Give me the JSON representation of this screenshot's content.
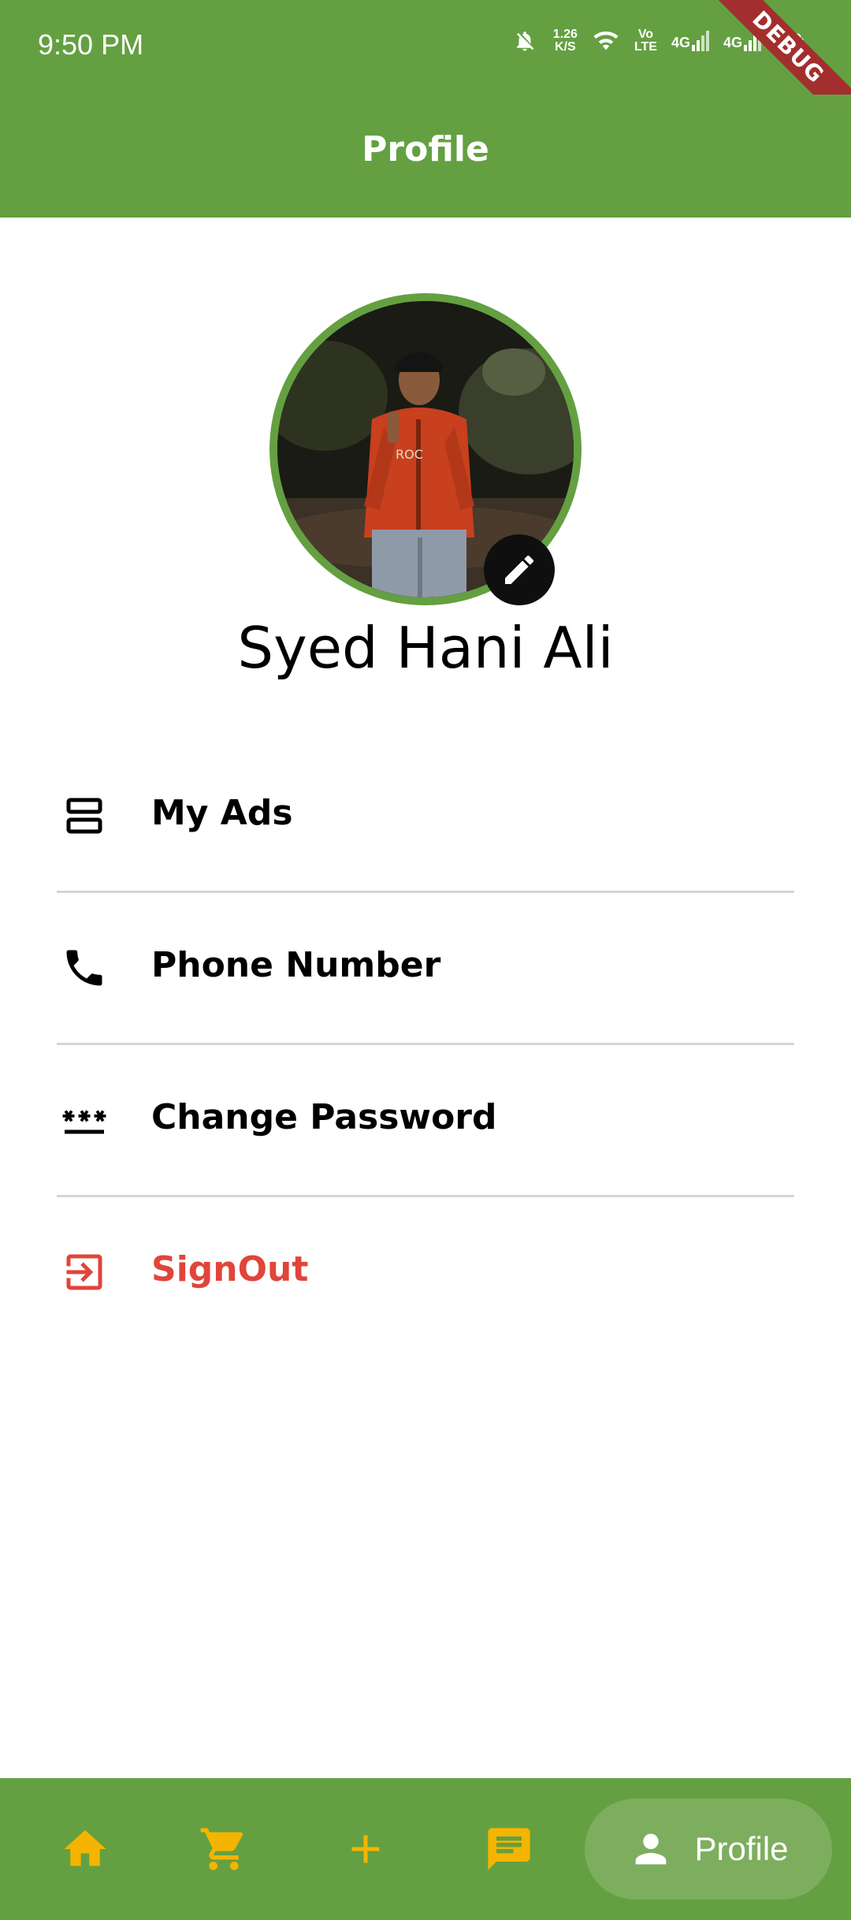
{
  "status_bar": {
    "time": "9:50 PM",
    "net_speed_value": "1.26",
    "net_speed_unit": "K/S",
    "volte_top": "Vo",
    "volte_bottom": "LTE",
    "network_1": "4G",
    "network_2": "4G",
    "debug_banner": "DEBUG"
  },
  "app_bar": {
    "title": "Profile"
  },
  "profile": {
    "name": "Syed Hani Ali"
  },
  "menu": {
    "items": [
      {
        "label": "My Ads",
        "icon": "ads-list-icon"
      },
      {
        "label": "Phone Number",
        "icon": "phone-icon"
      },
      {
        "label": "Change Password",
        "icon": "password-icon"
      },
      {
        "label": "SignOut",
        "icon": "signout-icon",
        "color": "#e0453a"
      }
    ]
  },
  "bottom_nav": {
    "items": [
      {
        "icon": "home-icon"
      },
      {
        "icon": "cart-icon"
      },
      {
        "icon": "add-icon"
      },
      {
        "icon": "chat-icon"
      },
      {
        "icon": "person-icon",
        "label": "Profile",
        "active": true
      }
    ]
  },
  "colors": {
    "primary_green": "#64a041",
    "nav_icon": "#f5b400",
    "signout_red": "#e0453a"
  }
}
